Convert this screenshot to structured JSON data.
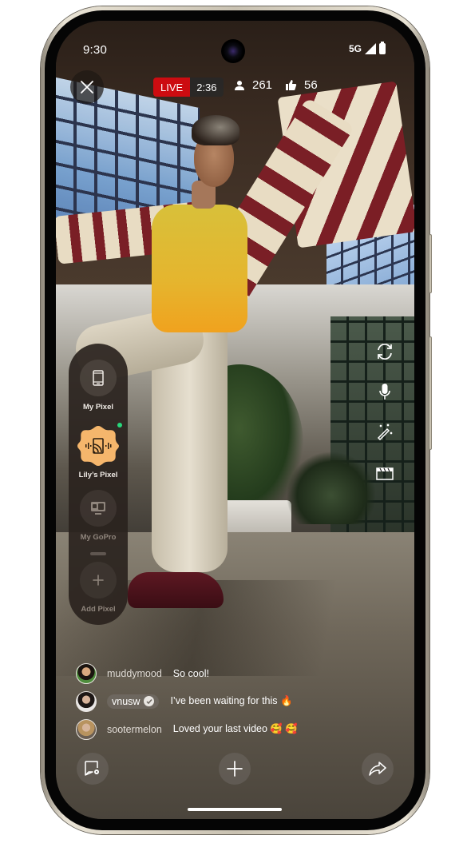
{
  "status_bar": {
    "time": "9:30",
    "network": "5G",
    "icons": [
      "signal-icon",
      "battery-icon"
    ]
  },
  "top_bar": {
    "close_icon": "close-icon",
    "live_label": "LIVE",
    "live_duration": "2:36",
    "viewers_icon": "person-icon",
    "viewers_count": "261",
    "likes_icon": "thumbs-up-icon",
    "likes_count": "56"
  },
  "device_switcher": {
    "devices": [
      {
        "label": "My Pixel",
        "icon": "phone-icon",
        "state": "available"
      },
      {
        "label": "Lily’s Pixel",
        "icon": "cast-icon",
        "state": "active",
        "status_dot_color": "#27d77b"
      },
      {
        "label": "My GoPro",
        "icon": "gopro-icon",
        "state": "disabled"
      },
      {
        "label": "Add Pixel",
        "icon": "plus-icon",
        "state": "disabled"
      }
    ],
    "active_color": "#f5b66c"
  },
  "right_tools": [
    {
      "name": "flip-camera",
      "icon": "flip-camera-icon"
    },
    {
      "name": "microphone",
      "icon": "microphone-icon"
    },
    {
      "name": "effects",
      "icon": "magic-wand-icon"
    },
    {
      "name": "clapperboard",
      "icon": "clapperboard-icon"
    }
  ],
  "chat": {
    "messages": [
      {
        "user": "muddymood",
        "verified": false,
        "text": "So cool!"
      },
      {
        "user": "vnusw",
        "verified": true,
        "text": "I’ve been waiting for this 🔥"
      },
      {
        "user": "sootermelon",
        "verified": false,
        "text": "Loved your last video 🥰 🥰"
      }
    ]
  },
  "bottom_bar": {
    "chat_settings_icon": "chat-settings-icon",
    "add_icon": "plus-icon",
    "share_icon": "share-icon"
  },
  "colors": {
    "live_red": "#cc0c11",
    "accent_orange": "#f5b66c",
    "online_green": "#27d77b"
  }
}
